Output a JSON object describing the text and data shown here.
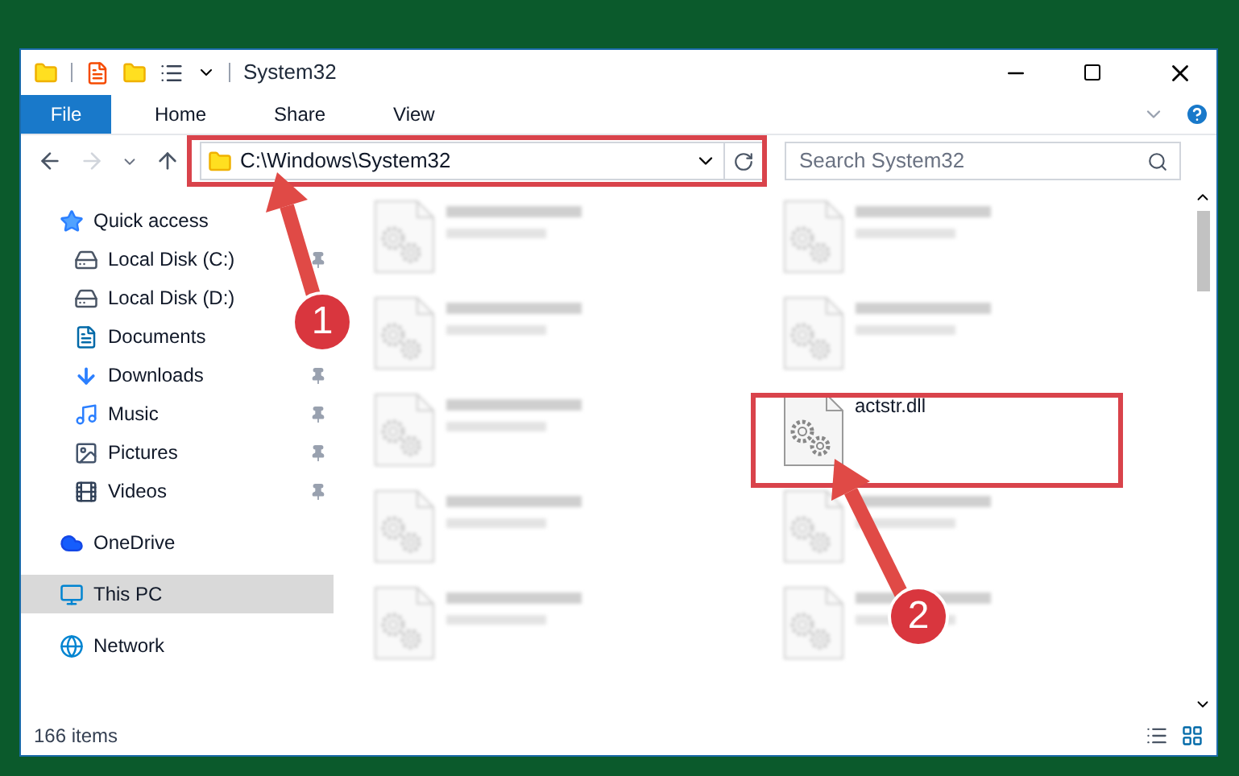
{
  "window": {
    "title": "System32"
  },
  "ribbon_tabs": [
    {
      "label": "File",
      "selected": true
    },
    {
      "label": "Home",
      "selected": false
    },
    {
      "label": "Share",
      "selected": false
    },
    {
      "label": "View",
      "selected": false
    }
  ],
  "address_bar": {
    "path": "C:\\Windows\\System32"
  },
  "search": {
    "placeholder": "Search System32"
  },
  "sidebar": {
    "items": [
      {
        "label": "Quick access",
        "selected": false,
        "children": [
          {
            "label": "Local Disk (C:)",
            "pinned": true
          },
          {
            "label": "Local Disk (D:)",
            "pinned": false
          },
          {
            "label": "Documents",
            "pinned": false
          },
          {
            "label": "Downloads",
            "pinned": true
          },
          {
            "label": "Music",
            "pinned": true
          },
          {
            "label": "Pictures",
            "pinned": true
          },
          {
            "label": "Videos",
            "pinned": true
          }
        ]
      },
      {
        "label": "OneDrive",
        "selected": false
      },
      {
        "label": "This PC",
        "selected": true
      },
      {
        "label": "Network",
        "selected": false
      }
    ]
  },
  "files": [
    {
      "kind": "blurred"
    },
    {
      "kind": "blurred"
    },
    {
      "kind": "blurred"
    },
    {
      "kind": "blurred"
    },
    {
      "kind": "blurred"
    },
    {
      "kind": "file",
      "name": "actstr.dll"
    },
    {
      "kind": "blurred"
    },
    {
      "kind": "blurred"
    },
    {
      "kind": "blurred"
    },
    {
      "kind": "blurred"
    }
  ],
  "status_bar": {
    "count": "166 items"
  },
  "annotations": [
    {
      "number": "1"
    },
    {
      "number": "2"
    }
  ]
}
